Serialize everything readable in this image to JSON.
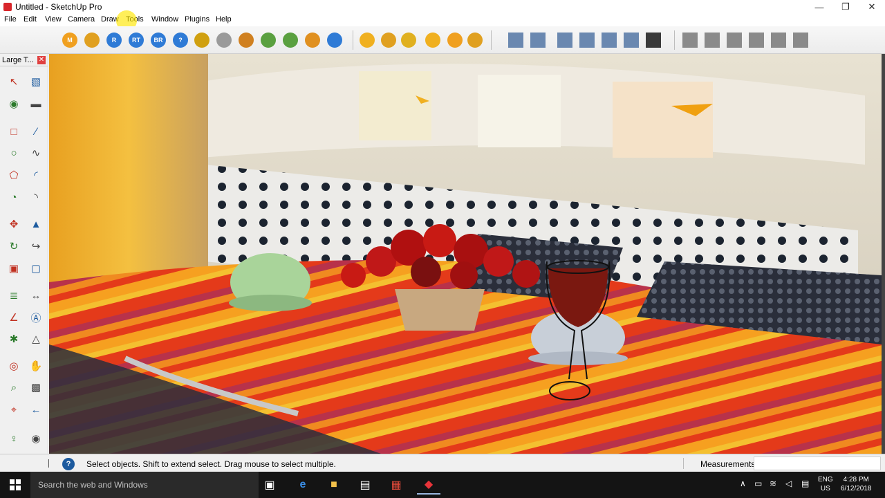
{
  "window": {
    "title": "Untitled - SketchUp Pro"
  },
  "menu": [
    "File",
    "Edit",
    "View",
    "Camera",
    "Draw",
    "Tools",
    "Window",
    "Plugins",
    "Help"
  ],
  "toolbar": {
    "render_buttons": [
      {
        "label": "M",
        "icon": "material-icon",
        "color": "#f0a020"
      },
      {
        "label": "",
        "icon": "tag-icon",
        "color": "#e0a020"
      },
      {
        "label": "R",
        "icon": "render-icon",
        "color": "#2f7bd6"
      },
      {
        "label": "RT",
        "icon": "realtime-render-icon",
        "color": "#2f7bd6"
      },
      {
        "label": "BR",
        "icon": "batch-render-icon",
        "color": "#2f7bd6"
      },
      {
        "label": "?",
        "icon": "help-icon",
        "color": "#2f7bd6"
      },
      {
        "label": "",
        "icon": "tag2-icon",
        "color": "#d0a010"
      },
      {
        "label": "",
        "icon": "sphere-icon",
        "color": "#9a9a9a"
      },
      {
        "label": "",
        "icon": "sun-icon",
        "color": "#d08020"
      },
      {
        "label": "",
        "icon": "tree-icon",
        "color": "#5aa040"
      },
      {
        "label": "",
        "icon": "tree2-icon",
        "color": "#5aa040"
      },
      {
        "label": "",
        "icon": "target-icon",
        "color": "#e09020"
      },
      {
        "label": "",
        "icon": "pause-icon",
        "color": "#2f7bd6"
      }
    ],
    "light_buttons": [
      {
        "icon": "sphere-light-icon",
        "color": "#f0b020"
      },
      {
        "icon": "spot-light-icon",
        "color": "#e0a020"
      },
      {
        "icon": "point-light-icon",
        "color": "#e0b020"
      },
      {
        "icon": "dome-light-icon",
        "color": "#f0b020"
      },
      {
        "icon": "omni-light-icon",
        "color": "#f0a020"
      },
      {
        "icon": "ies-light-icon",
        "color": "#e0a020"
      }
    ],
    "view_buttons": [
      {
        "icon": "iso-view-icon"
      },
      {
        "icon": "top-view-icon"
      },
      {
        "icon": "front-view-icon"
      },
      {
        "icon": "right-view-icon"
      },
      {
        "icon": "back-view-icon"
      },
      {
        "icon": "left-view-icon"
      },
      {
        "icon": "xray-icon"
      },
      {
        "icon": "shaded-icon"
      }
    ],
    "style_buttons": [
      {
        "icon": "warehouse-icon"
      },
      {
        "icon": "components-icon"
      },
      {
        "icon": "house-icon"
      },
      {
        "icon": "extension-icon"
      },
      {
        "icon": "house-outline-icon"
      },
      {
        "icon": "building-icon"
      }
    ]
  },
  "palette": {
    "title": "Large T...",
    "tools": [
      "select-tool-icon",
      "make-component-icon",
      "paint-bucket-icon",
      "eraser-icon",
      "rectangle-icon",
      "line-icon",
      "circle-icon",
      "freehand-icon",
      "polygon-icon",
      "arc-icon",
      "pie-icon",
      "two-point-arc-icon",
      "move-icon",
      "push-pull-icon",
      "rotate-icon",
      "follow-me-icon",
      "scale-icon",
      "offset-icon",
      "tape-measure-icon",
      "dimension-icon",
      "protractor-icon",
      "text-icon",
      "axes-icon",
      "3d-text-icon",
      "orbit-icon",
      "pan-icon",
      "zoom-icon",
      "zoom-window-icon",
      "zoom-extents-icon",
      "previous-view-icon",
      "position-camera-icon",
      "look-around-icon",
      "walk-icon",
      "section-plane-icon"
    ]
  },
  "status": {
    "hint": "Select objects. Shift to extend select. Drag mouse to select multiple.",
    "measurements_label": "Measurements",
    "measurements_value": ""
  },
  "taskbar": {
    "search_placeholder": "Search the web and Windows",
    "lang": "ENG",
    "region": "US",
    "time": "4:28 PM",
    "date": "6/12/2018"
  }
}
